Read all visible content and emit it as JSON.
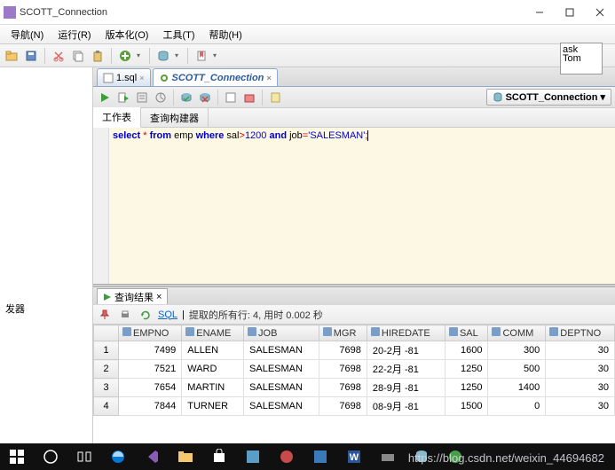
{
  "titlebar": {
    "title": "SCOTT_Connection"
  },
  "menubar": {
    "items": [
      "导航(N)",
      "运行(R)",
      "版本化(O)",
      "工具(T)",
      "帮助(H)"
    ]
  },
  "float_box": {
    "line1": "ask",
    "line2": "Tom"
  },
  "left_pane": {
    "item": "发器"
  },
  "tabs": [
    {
      "label": "1.sql",
      "active": false
    },
    {
      "label": "SCOTT_Connection",
      "active": true
    }
  ],
  "conn_label": "SCOTT_Connection",
  "sub_tabs": {
    "worksheet": "工作表",
    "builder": "查询构建器"
  },
  "sql": {
    "tokens": [
      {
        "t": "select",
        "c": "kw"
      },
      {
        "t": " "
      },
      {
        "t": "*",
        "c": "op"
      },
      {
        "t": " "
      },
      {
        "t": "from",
        "c": "kw"
      },
      {
        "t": " emp "
      },
      {
        "t": "where",
        "c": "kw"
      },
      {
        "t": " sal"
      },
      {
        "t": ">",
        "c": "op"
      },
      {
        "t": "1200",
        "c": "num"
      },
      {
        "t": " "
      },
      {
        "t": "and",
        "c": "kw"
      },
      {
        "t": " job"
      },
      {
        "t": "=",
        "c": "op"
      },
      {
        "t": "'SALESMAN'",
        "c": "str"
      },
      {
        "t": ";",
        "c": "op"
      }
    ]
  },
  "result_tab": {
    "label": "查询结果"
  },
  "result_status": {
    "sql_link": "SQL",
    "text": "提取的所有行: 4,  用时 0.002 秒"
  },
  "columns": [
    "EMPNO",
    "ENAME",
    "JOB",
    "MGR",
    "HIREDATE",
    "SAL",
    "COMM",
    "DEPTNO"
  ],
  "rows": [
    {
      "n": "1",
      "EMPNO": "7499",
      "ENAME": "ALLEN",
      "JOB": "SALESMAN",
      "MGR": "7698",
      "HIREDATE": "20-2月 -81",
      "SAL": "1600",
      "COMM": "300",
      "DEPTNO": "30"
    },
    {
      "n": "2",
      "EMPNO": "7521",
      "ENAME": "WARD",
      "JOB": "SALESMAN",
      "MGR": "7698",
      "HIREDATE": "22-2月 -81",
      "SAL": "1250",
      "COMM": "500",
      "DEPTNO": "30"
    },
    {
      "n": "3",
      "EMPNO": "7654",
      "ENAME": "MARTIN",
      "JOB": "SALESMAN",
      "MGR": "7698",
      "HIREDATE": "28-9月 -81",
      "SAL": "1250",
      "COMM": "1400",
      "DEPTNO": "30"
    },
    {
      "n": "4",
      "EMPNO": "7844",
      "ENAME": "TURNER",
      "JOB": "SALESMAN",
      "MGR": "7698",
      "HIREDATE": "08-9月 -81",
      "SAL": "1500",
      "COMM": "0",
      "DEPTNO": "30"
    }
  ],
  "watermark": "https://blog.csdn.net/weixin_44694682"
}
